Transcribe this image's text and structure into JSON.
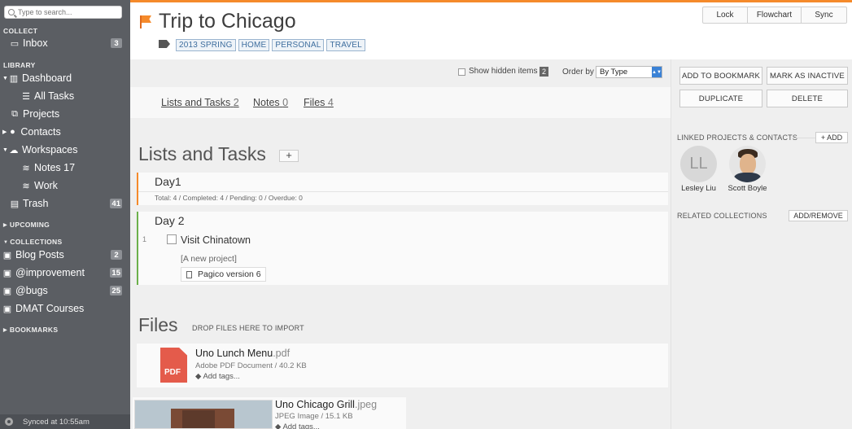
{
  "sidebar": {
    "search_placeholder": "Type to search...",
    "sections": {
      "collect": "COLLECT",
      "library": "LIBRARY",
      "upcoming": "UPCOMING",
      "collections": "COLLECTIONS",
      "bookmarks": "BOOKMARKS"
    },
    "collect_items": [
      {
        "label": "Inbox",
        "badge": "3",
        "icon": "inbox-icon"
      }
    ],
    "library_items": [
      {
        "label": "Dashboard",
        "icon": "dashboard-icon"
      },
      {
        "label": "All Tasks",
        "icon": "list-icon"
      },
      {
        "label": "Projects",
        "icon": "projects-icon"
      },
      {
        "label": "Contacts",
        "icon": "person-icon"
      },
      {
        "label": "Workspaces",
        "icon": "cloud-icon"
      },
      {
        "label": "Notes 17",
        "icon": "wifi-icon"
      },
      {
        "label": "Work",
        "icon": "wifi-icon"
      },
      {
        "label": "Trash",
        "badge": "41",
        "icon": "trash-icon"
      }
    ],
    "collection_items": [
      {
        "label": "Blog Posts",
        "badge": "2",
        "icon": "box-icon"
      },
      {
        "label": "@improvement",
        "badge": "15",
        "icon": "box-icon"
      },
      {
        "label": "@bugs",
        "badge": "25",
        "icon": "box-icon"
      },
      {
        "label": "DMAT Courses",
        "icon": "box-icon"
      }
    ],
    "synced": "Synced at 10:55am"
  },
  "header": {
    "title": "Trip to Chicago",
    "tags": [
      "2013 SPRING",
      "HOME",
      "PERSONAL",
      "TRAVEL"
    ],
    "buttons": [
      "Lock",
      "Flowchart",
      "Sync"
    ],
    "accent": "#f58a2b"
  },
  "options": {
    "show_hidden": "Show hidden items",
    "hidden_count": "2",
    "order_by": "Order by",
    "order_value": "By Type"
  },
  "tabs": [
    {
      "label": "Lists and Tasks",
      "count": "2"
    },
    {
      "label": "Notes",
      "count": "0"
    },
    {
      "label": "Files",
      "count": "4"
    }
  ],
  "lists": {
    "heading": "Lists and Tasks",
    "add": "+",
    "day1": {
      "name": "Day1",
      "stats": "Total: 4 / Completed: 4 / Pending: 0 / Overdue: 0"
    },
    "day2": {
      "name": "Day 2",
      "task_number": "1",
      "task": "Visit Chinatown",
      "note": "[A new project]",
      "link": "Pagico version 6"
    }
  },
  "files": {
    "heading": "Files",
    "drop": "DROP FILES HERE TO IMPORT",
    "items": [
      {
        "name": "Uno Lunch Menu",
        "ext": ".pdf",
        "meta": "Adobe PDF Document / 40.2 KB",
        "tags": "Add tags...",
        "icon_text": "PDF"
      },
      {
        "name": "Uno Chicago Grill",
        "ext": ".jpeg",
        "meta": "JPEG Image / 15.1 KB",
        "tags": "Add tags..."
      }
    ]
  },
  "right": {
    "add_bookmark": "ADD TO BOOKMARK",
    "mark_inactive": "MARK AS INACTIVE",
    "duplicate": "DUPLICATE",
    "delete": "DELETE",
    "linked_heading": "LINKED PROJECTS & CONTACTS",
    "add": "+ ADD",
    "contacts": [
      {
        "initials": "LL",
        "name": "Lesley Liu"
      },
      {
        "name": "Scott Boyle"
      }
    ],
    "related_heading": "RELATED COLLECTIONS",
    "add_remove": "ADD/REMOVE"
  }
}
